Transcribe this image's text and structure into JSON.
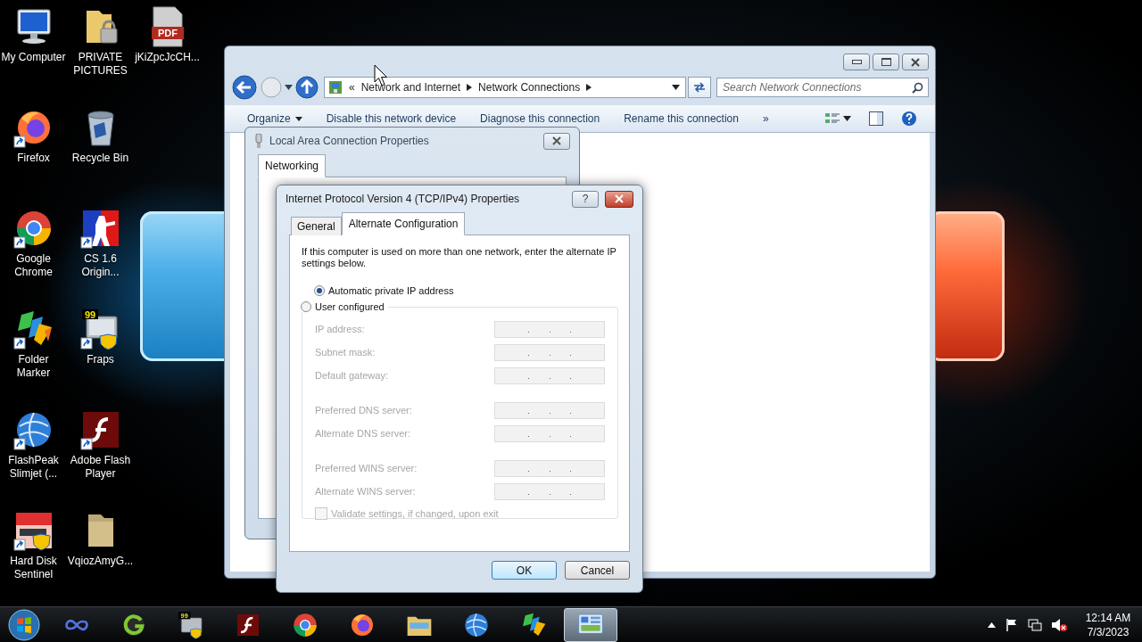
{
  "desktop": {
    "icons": [
      {
        "label": "My Computer",
        "kind": "computer",
        "shortcut": false
      },
      {
        "label": "Firefox",
        "kind": "firefox",
        "shortcut": true
      },
      {
        "label": "Google Chrome",
        "kind": "chrome",
        "shortcut": true
      },
      {
        "label": "Folder Marker",
        "kind": "folder-marker",
        "shortcut": true
      },
      {
        "label": "FlashPeak Slimjet (...",
        "kind": "globe",
        "shortcut": true
      },
      {
        "label": "Hard Disk Sentinel",
        "kind": "disk-sentinel",
        "shortcut": true
      },
      {
        "label": "PRIVATE PICTURES",
        "kind": "locked-folder",
        "shortcut": false
      },
      {
        "label": "Recycle Bin",
        "kind": "recycle-bin",
        "shortcut": false
      },
      {
        "label": "CS 1.6 Origin...",
        "kind": "game",
        "shortcut": true
      },
      {
        "label": "Fraps",
        "kind": "fraps",
        "shortcut": true,
        "badge": "99"
      },
      {
        "label": "Adobe Flash Player",
        "kind": "flash",
        "shortcut": true
      },
      {
        "label": "VqiozAmyG...",
        "kind": "folder",
        "shortcut": false
      },
      {
        "label": "jKiZpcJcCH...",
        "kind": "pdf",
        "shortcut": false,
        "badge": "PDF"
      }
    ]
  },
  "explorer": {
    "overflow_left": "«",
    "breadcrumb": [
      "Network and Internet",
      "Network Connections"
    ],
    "search": {
      "placeholder": "Search Network Connections"
    },
    "toolbar": [
      {
        "label": "Organize",
        "dropdown": true
      },
      {
        "label": "Disable this network device",
        "dropdown": false
      },
      {
        "label": "Diagnose this connection",
        "dropdown": false
      },
      {
        "label": "Rename this connection",
        "dropdown": false
      }
    ],
    "more": "»"
  },
  "lan_properties": {
    "title": "Local Area Connection Properties",
    "tabs": [
      {
        "label": "Networking",
        "selected": true
      }
    ]
  },
  "ipv4_dialog": {
    "title": "Internet Protocol Version 4 (TCP/IPv4) Properties",
    "help": "?",
    "tabs": [
      {
        "label": "General",
        "selected": false
      },
      {
        "label": "Alternate Configuration",
        "selected": true
      }
    ],
    "intro": "If this computer is used on more than one network, enter the alternate IP settings below.",
    "options": [
      {
        "label": "Automatic private IP address",
        "selected": true
      },
      {
        "label": "User configured",
        "selected": false
      }
    ],
    "field_groups": [
      {
        "fields": [
          {
            "label": "IP address:",
            "disabled": true
          },
          {
            "label": "Subnet mask:",
            "disabled": true
          },
          {
            "label": "Default gateway:",
            "disabled": true
          }
        ]
      },
      {
        "fields": [
          {
            "label": "Preferred DNS server:",
            "disabled": true
          },
          {
            "label": "Alternate DNS server:",
            "disabled": true
          }
        ]
      },
      {
        "fields": [
          {
            "label": "Preferred WINS server:",
            "disabled": true
          },
          {
            "label": "Alternate WINS server:",
            "disabled": true
          }
        ]
      }
    ],
    "validate": {
      "label": "Validate settings, if changed, upon exit",
      "checked": false,
      "disabled": true
    },
    "buttons": [
      {
        "label": "OK",
        "default": true
      },
      {
        "label": "Cancel",
        "default": false
      }
    ]
  },
  "taskbar": {
    "items": [
      {
        "kind": "infinity",
        "selected": false
      },
      {
        "kind": "g-app",
        "selected": false
      },
      {
        "kind": "fraps",
        "selected": false,
        "badge": "99"
      },
      {
        "kind": "flash",
        "selected": false
      },
      {
        "kind": "chrome",
        "selected": false
      },
      {
        "kind": "firefox",
        "selected": false
      },
      {
        "kind": "explorer",
        "selected": false
      },
      {
        "kind": "globe",
        "selected": false
      },
      {
        "kind": "folder-marker",
        "selected": false
      },
      {
        "kind": "network-panel",
        "selected": true
      }
    ],
    "volume_muted": true,
    "clock": {
      "time": "12:14 AM",
      "date": "7/3/2023"
    }
  }
}
